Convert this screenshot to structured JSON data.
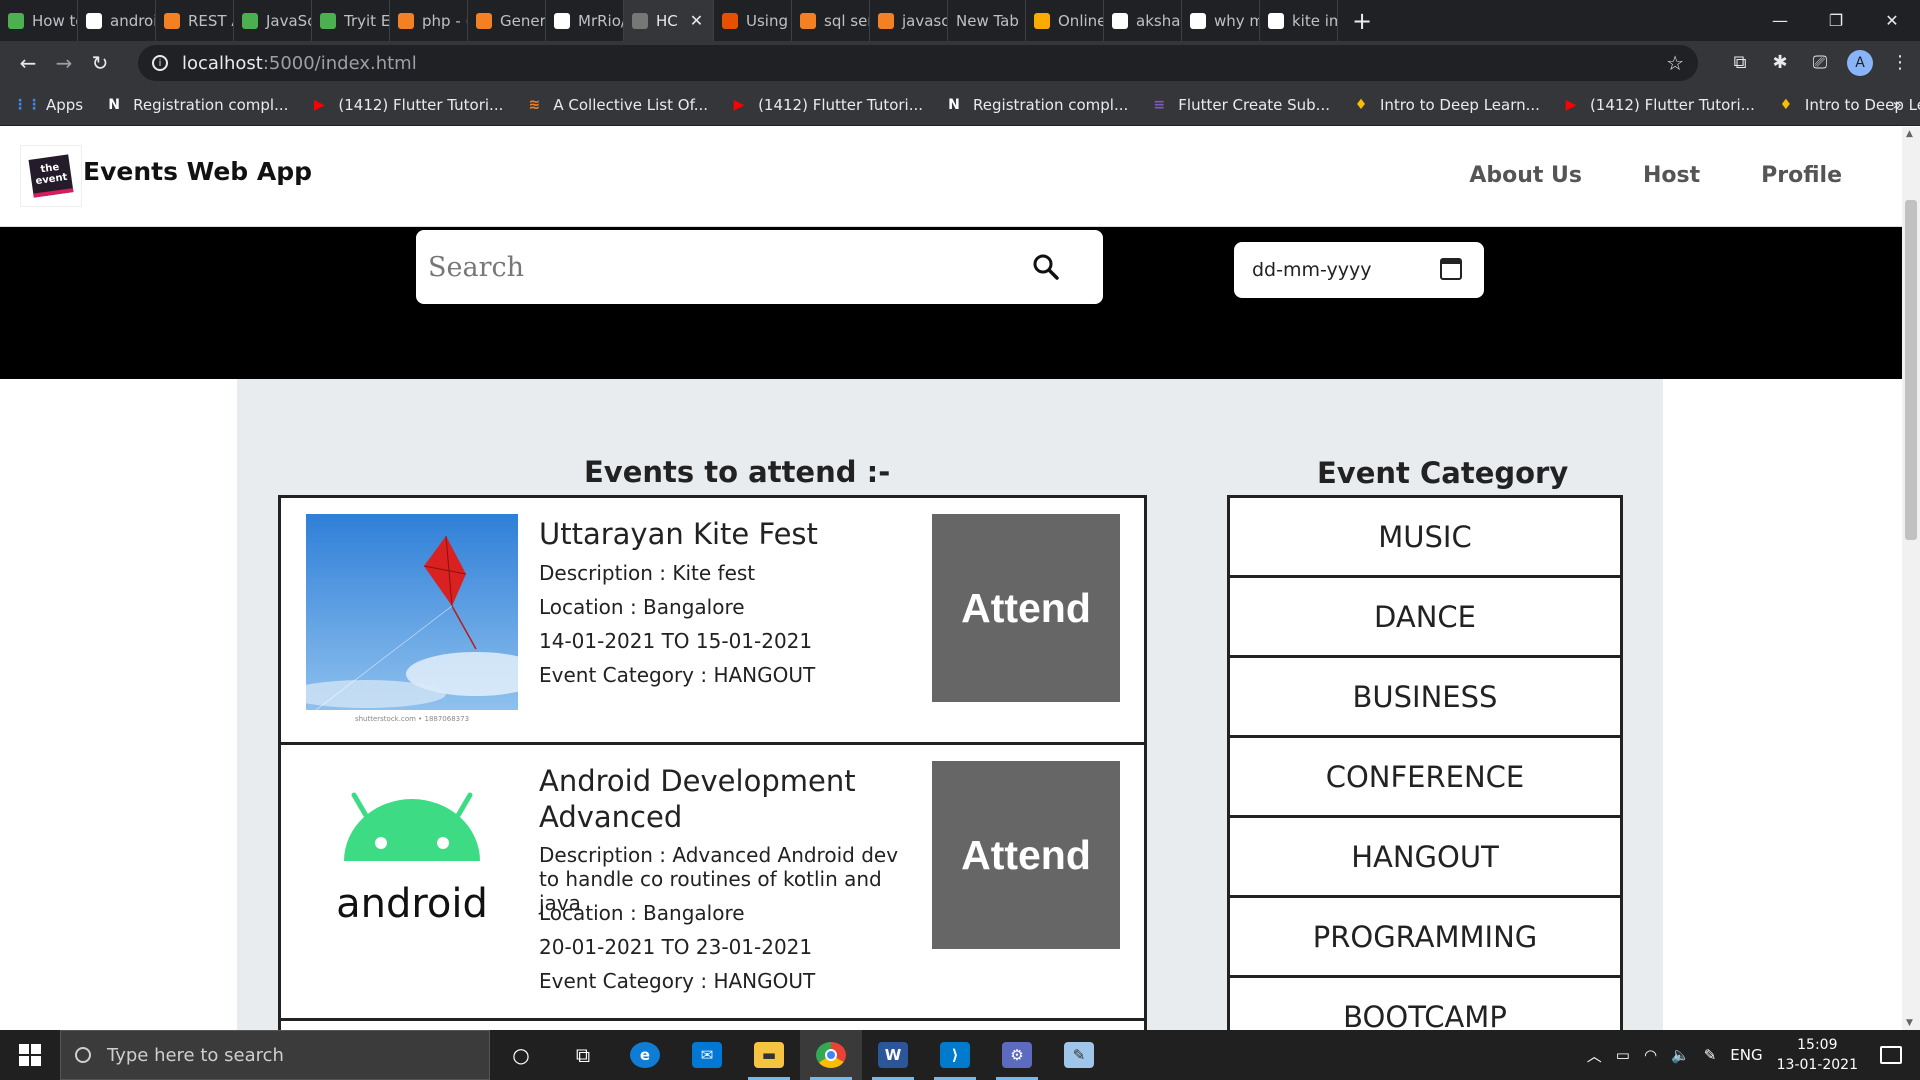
{
  "browser": {
    "tabs": [
      {
        "label": "How to",
        "color": "#4caf50",
        "active": false
      },
      {
        "label": "androi",
        "color": "#fff",
        "active": false
      },
      {
        "label": "REST A",
        "color": "#f48024",
        "active": false
      },
      {
        "label": "JavaSc",
        "color": "#4caf50",
        "active": false
      },
      {
        "label": "Tryit Ec",
        "color": "#4caf50",
        "active": false
      },
      {
        "label": "php - (",
        "color": "#f48024",
        "active": false
      },
      {
        "label": "Genera",
        "color": "#f48024",
        "active": false
      },
      {
        "label": "MrRio/",
        "color": "#fff",
        "active": false
      },
      {
        "label": "HC",
        "color": "#777",
        "active": true
      },
      {
        "label": "Using",
        "color": "#e65100",
        "active": false
      },
      {
        "label": "sql sen",
        "color": "#f48024",
        "active": false
      },
      {
        "label": "javascr",
        "color": "#f48024",
        "active": false
      },
      {
        "label": "New Tab",
        "color": "",
        "active": false
      },
      {
        "label": "Online",
        "color": "#f9ab00",
        "active": false
      },
      {
        "label": "akshay",
        "color": "#fff",
        "active": false
      },
      {
        "label": "why m",
        "color": "#fff",
        "active": false
      },
      {
        "label": "kite im",
        "color": "#fff",
        "active": false
      }
    ],
    "new_tab": "+",
    "url_host": "localhost",
    "url_path": ":5000/index.html",
    "avatar_letter": "A",
    "bookmarks": [
      {
        "label": "Apps",
        "icon": "apps-icon",
        "color": "#4285f4",
        "glyph": "⋮⋮"
      },
      {
        "label": "Registration compl...",
        "icon": "notion-icon",
        "color": "#fff",
        "glyph": "N"
      },
      {
        "label": "(1412) Flutter Tutori...",
        "icon": "youtube-icon",
        "color": "#f00",
        "glyph": "▶"
      },
      {
        "label": "A Collective List Of...",
        "icon": "stackoverflow-icon",
        "color": "#f48024",
        "glyph": "≋"
      },
      {
        "label": "(1412) Flutter Tutori...",
        "icon": "youtube-icon",
        "color": "#f00",
        "glyph": "▶"
      },
      {
        "label": "Registration compl...",
        "icon": "notion-icon",
        "color": "#fff",
        "glyph": "N"
      },
      {
        "label": "Flutter Create Sub...",
        "icon": "form-icon",
        "color": "#7e57c2",
        "glyph": "≡"
      },
      {
        "label": "Intro to Deep Learn...",
        "icon": "udacity-icon",
        "color": "#fbbc04",
        "glyph": "♦"
      },
      {
        "label": "(1412) Flutter Tutori...",
        "icon": "youtube-icon",
        "color": "#f00",
        "glyph": "▶"
      },
      {
        "label": "Intro to Deep Learn...",
        "icon": "udacity-icon",
        "color": "#fbbc04",
        "glyph": "♦"
      }
    ],
    "bookmarks_more": "»"
  },
  "site": {
    "brand": "Events Web App",
    "logo_text": "the event",
    "nav": [
      "About Us",
      "Host",
      "Profile"
    ],
    "search_placeholder": "Search",
    "date_placeholder": "dd-mm-yyyy"
  },
  "events_section": {
    "title": "Events to attend :-",
    "attend_label": "Attend",
    "items": [
      {
        "title": "Uttarayan Kite Fest",
        "description": "Description : Kite fest",
        "location": "Location : Bangalore",
        "dates": "14-01-2021 TO 15-01-2021",
        "category": "Event Category : HANGOUT",
        "image": "kite",
        "image_caption": "shutterstock.com • 1887068373"
      },
      {
        "title": "Android Development Advanced",
        "description": "Description : Advanced Android dev to handle co routines of kotlin and java",
        "location": "Location : Bangalore",
        "dates": "20-01-2021 TO 23-01-2021",
        "category": "Event Category : HANGOUT",
        "image": "android",
        "image_caption": "android"
      }
    ]
  },
  "category_section": {
    "title": "Event Category",
    "items": [
      "MUSIC",
      "DANCE",
      "BUSINESS",
      "CONFERENCE",
      "HANGOUT",
      "PROGRAMMING",
      "BOOTCAMP"
    ]
  },
  "taskbar": {
    "search_placeholder": "Type here to search",
    "lang": "ENG",
    "time": "15:09",
    "date": "13-01-2021"
  }
}
